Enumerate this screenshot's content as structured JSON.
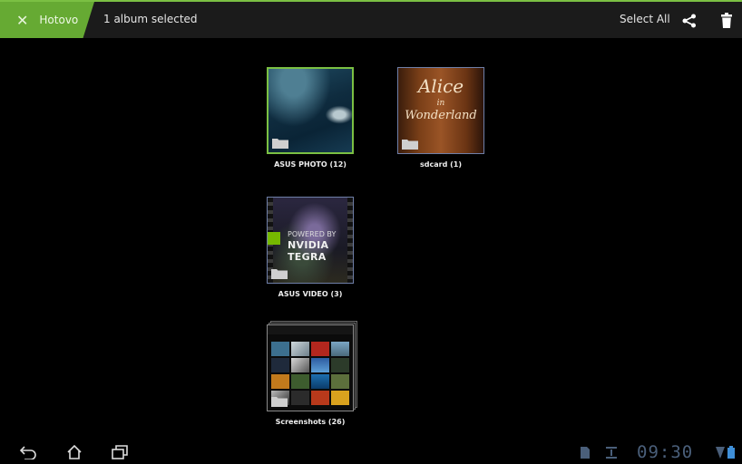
{
  "actionbar": {
    "done_label": "Hotovo",
    "selection_text": "1 album selected",
    "select_all_label": "Select All",
    "accent_color": "#66aa33"
  },
  "albums": [
    {
      "label": "ASUS PHOTO (12)",
      "selected": true
    },
    {
      "label": "sdcard (1)",
      "selected": false
    },
    {
      "label": "ASUS VIDEO (3)",
      "selected": false
    },
    {
      "label": "Screenshots (26)",
      "selected": false
    }
  ],
  "thumbs": {
    "sdcard_text": [
      "Alice",
      "in",
      "Wonderland"
    ],
    "video_text": [
      "POWERED BY",
      "NVIDIA TEGRA"
    ]
  },
  "icons": [
    "close-icon",
    "share-icon",
    "trash-icon",
    "folder-icon",
    "back-icon",
    "home-icon",
    "recent-apps-icon",
    "sd-card-icon",
    "usb-icon",
    "wifi-icon",
    "battery-icon"
  ],
  "system": {
    "clock": "09:30"
  }
}
